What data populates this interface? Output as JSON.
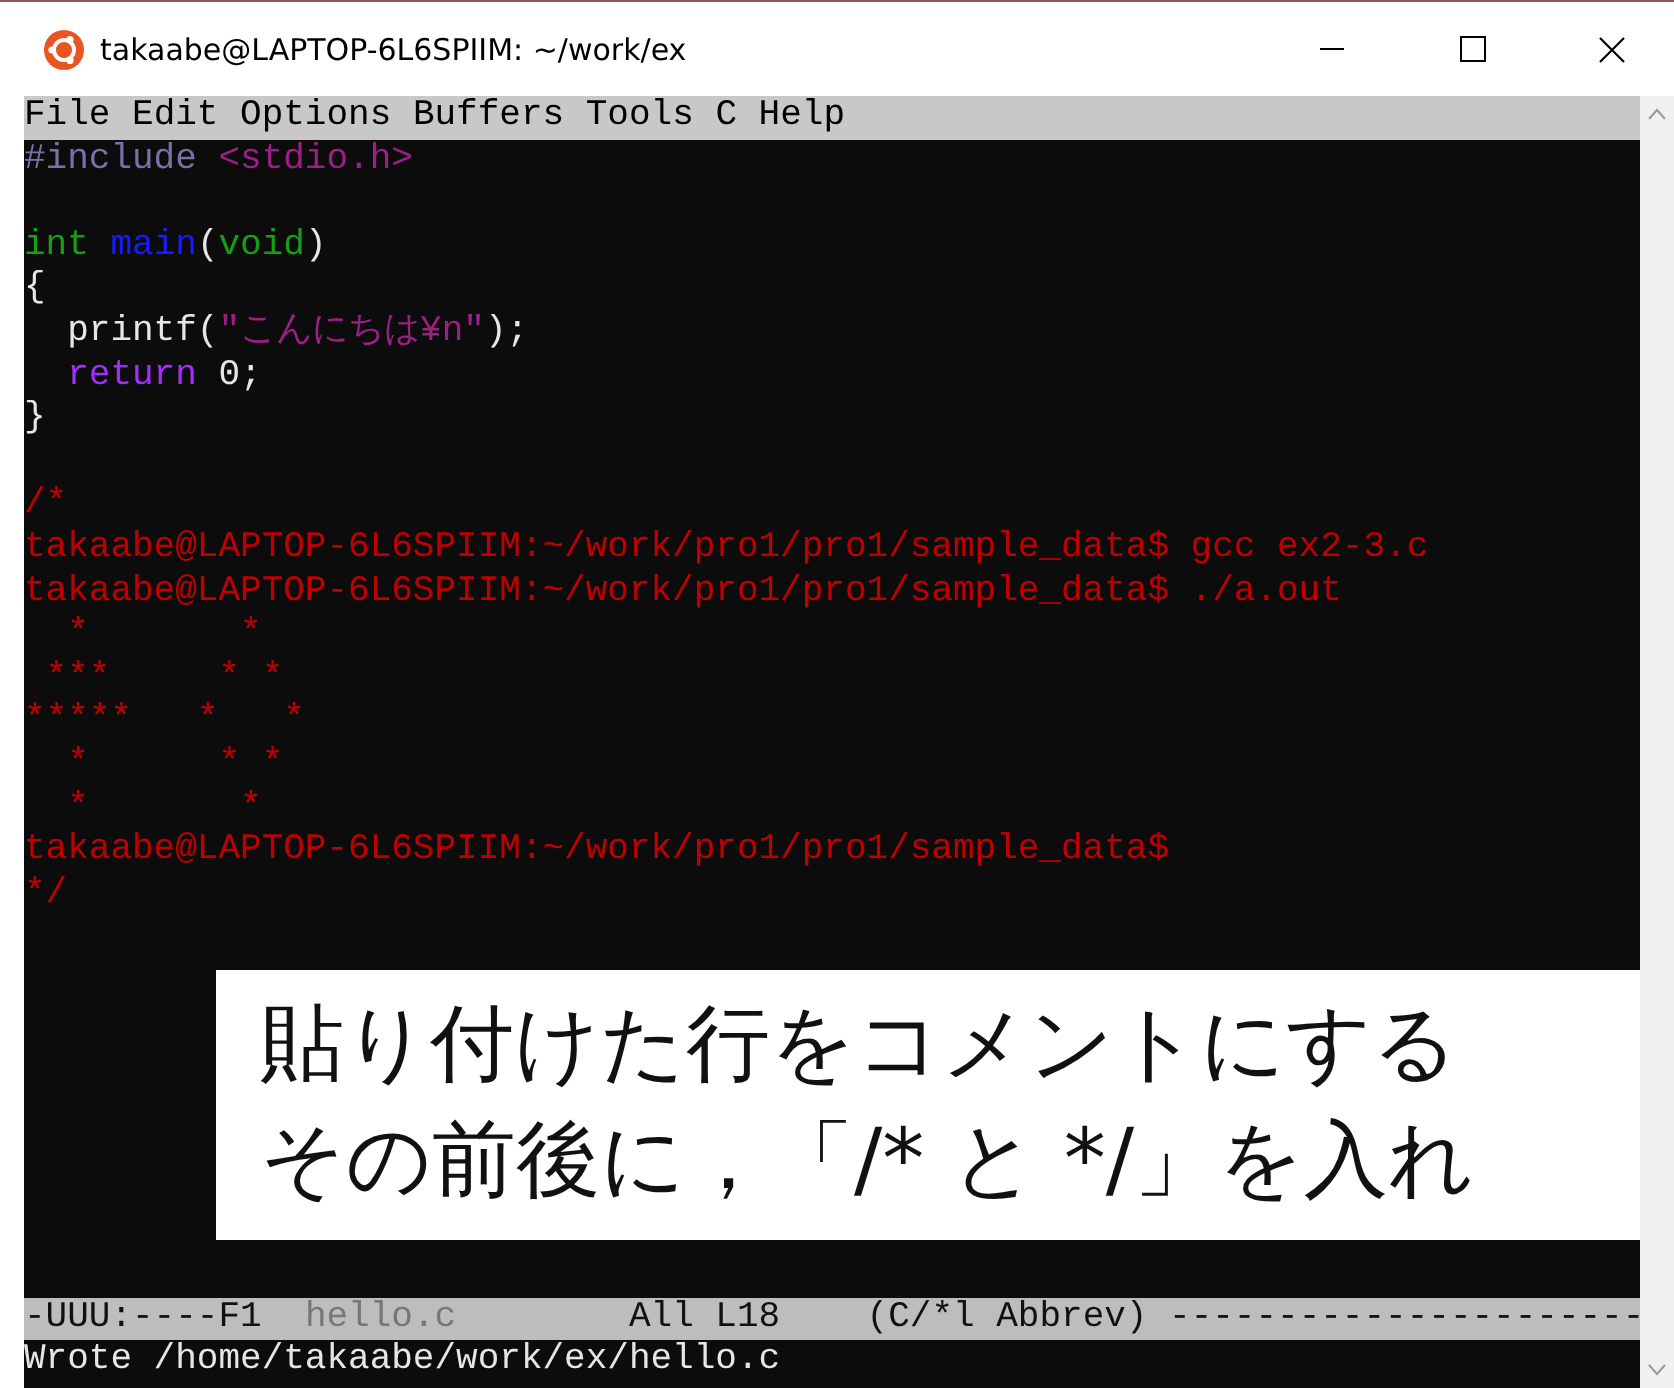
{
  "window": {
    "title": "takaabe@LAPTOP-6L6SPIIM: ~/work/ex"
  },
  "menu_bar": [
    "File",
    "Edit",
    "Options",
    "Buffers",
    "Tools",
    "C",
    "Help"
  ],
  "editor_lines": [
    {
      "kind": "code",
      "segments": [
        {
          "kind": "preprocessor",
          "text": "#include "
        },
        {
          "kind": "string",
          "text": "<stdio.h>"
        }
      ]
    },
    {
      "kind": "blank"
    },
    {
      "kind": "code",
      "segments": [
        {
          "kind": "type",
          "text": "int "
        },
        {
          "kind": "function",
          "text": "main"
        },
        {
          "kind": "plain",
          "text": "("
        },
        {
          "kind": "type",
          "text": "void"
        },
        {
          "kind": "plain",
          "text": ")"
        }
      ]
    },
    {
      "kind": "code",
      "segments": [
        {
          "kind": "plain",
          "text": "{"
        }
      ]
    },
    {
      "kind": "code",
      "segments": [
        {
          "kind": "plain",
          "text": "  printf("
        },
        {
          "kind": "string",
          "text": "\"こんにちは¥n\""
        },
        {
          "kind": "plain",
          "text": ");"
        }
      ]
    },
    {
      "kind": "code",
      "segments": [
        {
          "kind": "keyword",
          "text": "  return"
        },
        {
          "kind": "plain",
          "text": " 0;"
        }
      ]
    },
    {
      "kind": "code",
      "segments": [
        {
          "kind": "plain",
          "text": "}"
        }
      ]
    },
    {
      "kind": "blank"
    },
    {
      "kind": "code",
      "segments": [
        {
          "kind": "comment",
          "text": "/*"
        }
      ]
    },
    {
      "kind": "code",
      "segments": [
        {
          "kind": "comment",
          "text": "takaabe@LAPTOP-6L6SPIIM:~/work/pro1/pro1/sample_data$ gcc ex2-3.c"
        }
      ]
    },
    {
      "kind": "code",
      "segments": [
        {
          "kind": "comment",
          "text": "takaabe@LAPTOP-6L6SPIIM:~/work/pro1/pro1/sample_data$ ./a.out"
        }
      ]
    },
    {
      "kind": "art",
      "segments": [
        {
          "kind": "comment",
          "text": "  *"
        },
        {
          "kind": "comment",
          "text": "       *"
        }
      ]
    },
    {
      "kind": "art",
      "segments": [
        {
          "kind": "comment",
          "text": " *"
        },
        {
          "kind": "comment",
          "text": "*"
        },
        {
          "kind": "comment",
          "text": "*"
        },
        {
          "kind": "comment",
          "text": "     *"
        },
        {
          "kind": "comment",
          "text": " *"
        }
      ]
    },
    {
      "kind": "art",
      "segments": [
        {
          "kind": "comment",
          "text": "*"
        },
        {
          "kind": "comment",
          "text": "*"
        },
        {
          "kind": "comment",
          "text": "*"
        },
        {
          "kind": "comment",
          "text": "*"
        },
        {
          "kind": "comment",
          "text": "*"
        },
        {
          "kind": "comment",
          "text": "   *"
        },
        {
          "kind": "comment",
          "text": "   *"
        }
      ]
    },
    {
      "kind": "art",
      "segments": [
        {
          "kind": "comment",
          "text": "  *"
        },
        {
          "kind": "comment",
          "text": "      *"
        },
        {
          "kind": "comment",
          "text": " *"
        }
      ]
    },
    {
      "kind": "art",
      "segments": [
        {
          "kind": "comment",
          "text": "  *"
        },
        {
          "kind": "comment",
          "text": "       *"
        }
      ]
    },
    {
      "kind": "code",
      "segments": [
        {
          "kind": "comment",
          "text": "takaabe@LAPTOP-6L6SPIIM:~/work/pro1/pro1/sample_data$"
        }
      ]
    },
    {
      "kind": "code",
      "segments": [
        {
          "kind": "comment",
          "text": "*/"
        }
      ]
    }
  ],
  "annotation": {
    "lines": [
      "貼り付けた行をコメントにする",
      "その前後に，「/* と */」を入れ"
    ]
  },
  "mode_line": [
    {
      "kind": "normal",
      "text": "-UUU:----F1  "
    },
    {
      "kind": "buffer-name",
      "text": "hello.c"
    },
    {
      "kind": "normal",
      "text": "        All L18    (C/*l Abbrev) ----------------------"
    }
  ],
  "echo_area": "Wrote /home/takaabe/work/ex/hello.c"
}
